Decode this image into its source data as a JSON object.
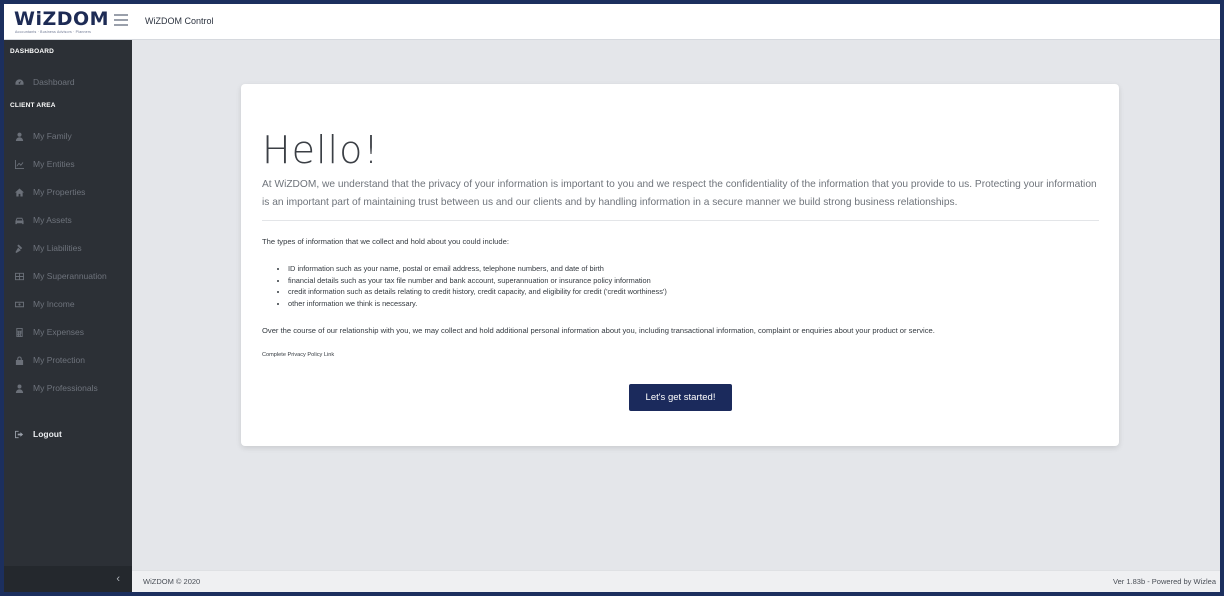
{
  "brand": {
    "logo_text": "WiZDOM",
    "tagline": "Accountants · Business Advisors · Planners",
    "menu_icon": "hamburger-icon"
  },
  "header": {
    "title": "WiZDOM Control"
  },
  "sidebar": {
    "sections": [
      {
        "label": "DASHBOARD"
      },
      {
        "label": "CLIENT AREA"
      }
    ],
    "items": [
      {
        "label": "Dashboard",
        "icon": "tachometer-icon"
      },
      {
        "label": "My Family",
        "icon": "user-icon"
      },
      {
        "label": "My Entities",
        "icon": "chart-icon"
      },
      {
        "label": "My Properties",
        "icon": "home-icon"
      },
      {
        "label": "My Assets",
        "icon": "car-icon"
      },
      {
        "label": "My Liabilities",
        "icon": "gavel-icon"
      },
      {
        "label": "My Superannuation",
        "icon": "calculator-grid-icon"
      },
      {
        "label": "My Income",
        "icon": "money-icon"
      },
      {
        "label": "My Expenses",
        "icon": "calculator-icon"
      },
      {
        "label": "My Protection",
        "icon": "lock-icon"
      },
      {
        "label": "My Professionals",
        "icon": "user-tie-icon"
      }
    ],
    "logout": {
      "label": "Logout",
      "icon": "sign-out-icon"
    },
    "collapse_icon": "chevron-left-icon"
  },
  "card": {
    "heading": "Hello!",
    "intro": "At WiZDOM, we understand that the privacy of your information is important to you and we respect the confidentiality of the information that you provide to us. Protecting your information is an important part of maintaining trust between us and our clients and by handling information in a secure manner we build strong business relationships.",
    "types_heading": "The types of information that we collect and hold about you could include:",
    "bullets": [
      "ID information such as your name, postal or email address, telephone numbers, and date of birth",
      "financial details such as your tax file number and bank account, superannuation or insurance policy information",
      "credit information such as details relating to credit history, credit capacity, and eligibility for credit ('credit worthiness')",
      "other information we think is necessary."
    ],
    "over_course": "Over the course of our relationship with you, we may collect and hold additional personal information about you, including transactional information, complaint or enquiries about your product or service.",
    "privacy_link": "Complete Privacy Policy Link",
    "cta": "Let's get started!"
  },
  "footer": {
    "copyright": "WiZDOM © 2020",
    "version": "Ver 1.83b - Powered by Wizlea"
  },
  "colors": {
    "brand_navy": "#1b2a5c",
    "sidebar_bg": "#2c3036",
    "page_bg": "#e4e6ea",
    "outer_border": "#1c2f5e"
  }
}
